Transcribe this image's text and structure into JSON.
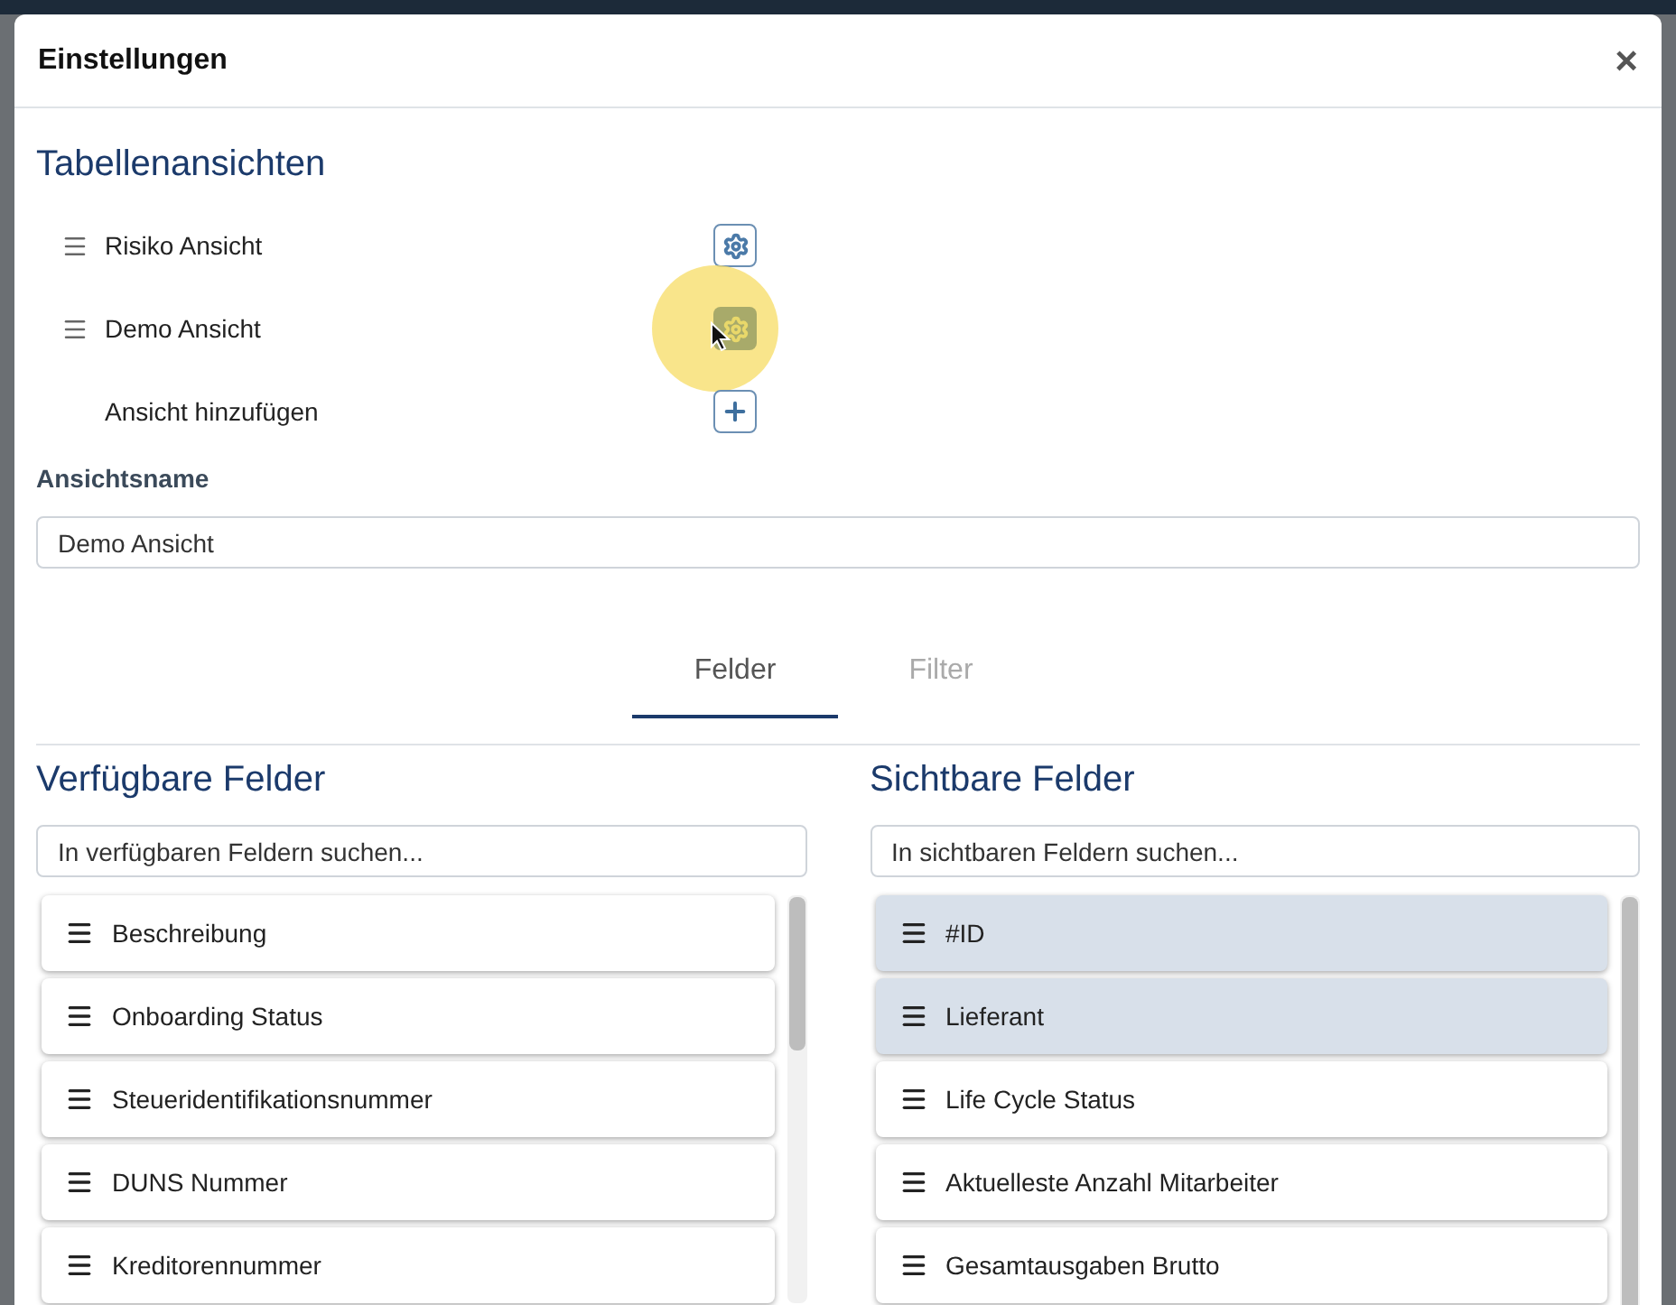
{
  "dialog": {
    "title": "Einstellungen",
    "close": "×"
  },
  "views_section": {
    "title": "Tabellenansichten",
    "views": [
      {
        "kind": "view",
        "name": "Risiko Ansicht",
        "active": false
      },
      {
        "kind": "view",
        "name": "Demo Ansicht",
        "active": true
      },
      {
        "kind": "add",
        "name": "Ansicht hinzufügen",
        "active": false
      }
    ]
  },
  "view_name": {
    "label": "Ansichtsname",
    "value": "Demo Ansicht"
  },
  "tabs": [
    {
      "label": "Felder",
      "selected": true
    },
    {
      "label": "Filter",
      "selected": false
    }
  ],
  "available": {
    "title": "Verfügbare Felder",
    "search_placeholder": "In verfügbaren Feldern suchen...",
    "fields": [
      {
        "name": "Beschreibung",
        "locked": false
      },
      {
        "name": "Onboarding Status",
        "locked": false
      },
      {
        "name": "Steueridentifikationsnummer",
        "locked": false
      },
      {
        "name": "DUNS Nummer",
        "locked": false
      },
      {
        "name": "Kreditorennummer",
        "locked": false
      }
    ]
  },
  "visible": {
    "title": "Sichtbare Felder",
    "search_placeholder": "In sichtbaren Feldern suchen...",
    "fields": [
      {
        "name": "#ID",
        "locked": true
      },
      {
        "name": "Lieferant",
        "locked": true
      },
      {
        "name": "Life Cycle Status",
        "locked": false
      },
      {
        "name": "Aktuelleste Anzahl Mitarbeiter",
        "locked": false
      },
      {
        "name": "Gesamtausgaben Brutto",
        "locked": false
      }
    ]
  }
}
